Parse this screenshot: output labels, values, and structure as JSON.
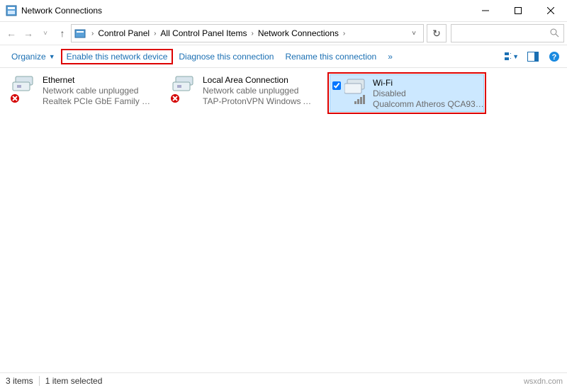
{
  "window": {
    "title": "Network Connections"
  },
  "breadcrumb": {
    "a": "Control Panel",
    "b": "All Control Panel Items",
    "c": "Network Connections"
  },
  "toolbar": {
    "organize": "Organize",
    "enable": "Enable this network device",
    "diagnose": "Diagnose this connection",
    "rename": "Rename this connection",
    "more": "»"
  },
  "items": {
    "ethernet": {
      "name": "Ethernet",
      "status": "Network cable unplugged",
      "device": "Realtek PCIe GbE Family Cont..."
    },
    "lan": {
      "name": "Local Area Connection",
      "status": "Network cable unplugged",
      "device": "TAP-ProtonVPN Windows Ad..."
    },
    "wifi": {
      "name": "Wi-Fi",
      "status": "Disabled",
      "device": "Qualcomm Atheros QCA9377..."
    }
  },
  "status": {
    "count": "3 items",
    "selected": "1 item selected"
  },
  "watermark": "wsxdn.com"
}
